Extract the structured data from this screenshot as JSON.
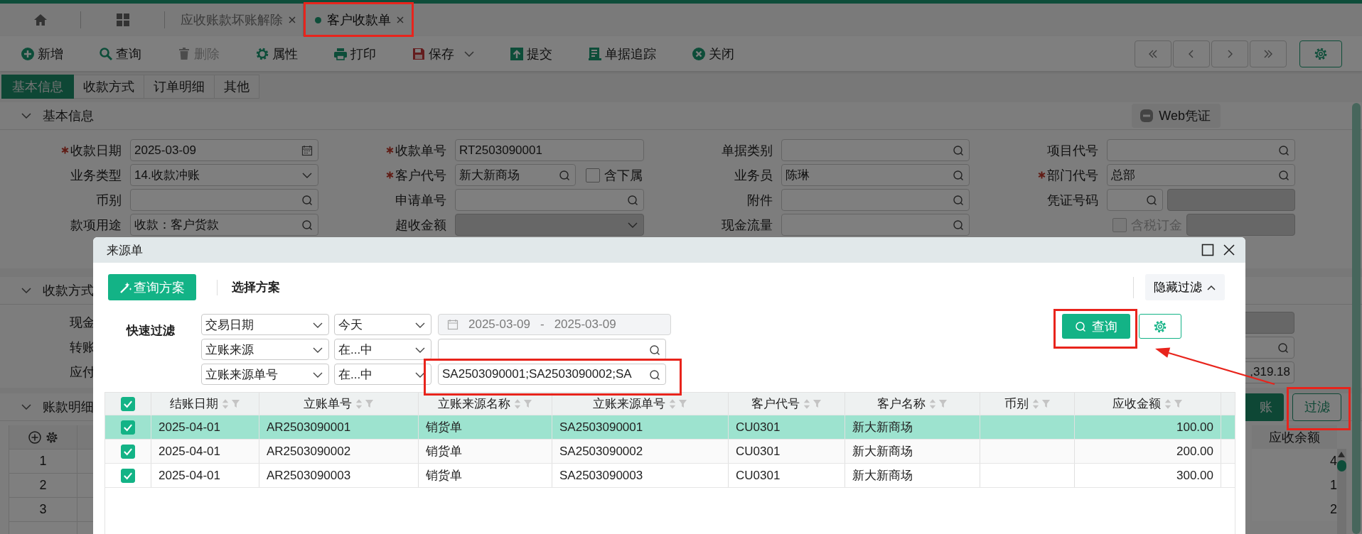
{
  "tab_bar": {
    "tabs": [
      {
        "label": "应收账款坏账解除",
        "selected": false
      },
      {
        "label": "客户收款单",
        "selected": true
      }
    ]
  },
  "toolbar": {
    "buttons": [
      {
        "label": "新增",
        "kind": "add",
        "disabled": false,
        "has_menu": false
      },
      {
        "label": "查询",
        "kind": "search",
        "disabled": false,
        "has_menu": false
      },
      {
        "label": "删除",
        "kind": "delete",
        "disabled": true,
        "has_menu": false
      },
      {
        "label": "属性",
        "kind": "properties",
        "disabled": false,
        "has_menu": false
      },
      {
        "label": "打印",
        "kind": "print",
        "disabled": false,
        "has_menu": false
      },
      {
        "label": "保存",
        "kind": "save",
        "disabled": false,
        "has_menu": true
      },
      {
        "label": "提交",
        "kind": "submit",
        "disabled": false,
        "has_menu": false
      },
      {
        "label": "单据追踪",
        "kind": "track",
        "disabled": false,
        "has_menu": false
      },
      {
        "label": "关闭",
        "kind": "close",
        "disabled": false,
        "has_menu": false
      }
    ]
  },
  "form_tabs": [
    {
      "label": "基本信息",
      "selected": true
    },
    {
      "label": "收款方式",
      "selected": false
    },
    {
      "label": "订单明细",
      "selected": false
    },
    {
      "label": "其他",
      "selected": false
    }
  ],
  "basic_info": {
    "title": "基本信息",
    "expanded": true,
    "voucher_button": "Web凭证",
    "fields": [
      {
        "label": "收款日期",
        "required": true,
        "kind": "date",
        "value": "2025-03-09",
        "disabled": false
      },
      {
        "label": "收款单号",
        "required": true,
        "kind": "text",
        "value": "RT2503090001",
        "disabled": false
      },
      {
        "label": "单据类别",
        "required": false,
        "kind": "lookup",
        "disabled": false
      },
      {
        "label": "项目代号",
        "required": false,
        "kind": "lookup",
        "disabled": false
      },
      {
        "label": "业务类型",
        "required": false,
        "kind": "select",
        "value": "14.收款冲账",
        "disabled": false
      },
      {
        "label": "客户代号",
        "required": true,
        "kind": "lookup_check",
        "value": "新大新商场",
        "disabled": false,
        "option": {
          "label": "含下属",
          "checked": false
        }
      },
      {
        "label": "业务员",
        "required": false,
        "kind": "lookup",
        "value": "陈琳",
        "disabled": false
      },
      {
        "label": "部门代号",
        "required": true,
        "kind": "lookup",
        "value": "总部",
        "disabled": false
      },
      {
        "label": "币别",
        "required": false,
        "kind": "lookup",
        "disabled": false
      },
      {
        "label": "申请单号",
        "required": false,
        "kind": "lookup",
        "disabled": false
      },
      {
        "label": "附件",
        "required": false,
        "kind": "lookup",
        "disabled": false
      },
      {
        "label": "凭证号码",
        "required": false,
        "kind": "voucher",
        "disabled": false
      },
      {
        "label": "款项用途",
        "required": false,
        "kind": "lookup",
        "value": "收款：客户货款",
        "disabled": false
      },
      {
        "label": "超收金额",
        "required": false,
        "kind": "select",
        "disabled": true
      },
      {
        "label": "现金流量",
        "required": false,
        "kind": "lookup",
        "disabled": false
      },
      {
        "required": false,
        "kind": "check_field",
        "disabled": true,
        "option": {
          "label": "含税订金",
          "checked": false
        }
      }
    ]
  },
  "payment_section": {
    "title": "收款方式",
    "expanded": true,
    "rows": [
      {
        "label": "现金",
        "kind": "text"
      },
      {
        "label": "转账",
        "kind": "lookup"
      },
      {
        "label": "应付",
        "kind": "text",
        "value": ",319.18"
      }
    ]
  },
  "detail_section": {
    "title": "账款明细",
    "expanded": true,
    "buttons": [
      {
        "label": "账",
        "kind": "primary"
      },
      {
        "label": "过滤",
        "kind": "outline"
      }
    ],
    "balance_column": "应收余额",
    "rows": [
      {
        "number": "1",
        "balance": "4"
      },
      {
        "number": "2",
        "balance": "1"
      },
      {
        "number": "3",
        "balance": "2"
      }
    ]
  },
  "dialog": {
    "title": "来源单",
    "scheme_button": "查询方案",
    "scheme_select": "选择方案",
    "hide_filter_button": "隐藏过滤",
    "quick_filter_label": "快速过滤",
    "query_button": "查询",
    "filters": [
      {
        "field": "交易日期",
        "operator": "今天",
        "kind": "date_range",
        "from": "2025-03-09",
        "to": "2025-03-09",
        "separator": "-"
      },
      {
        "field": "立账来源",
        "operator": "在...中",
        "kind": "lookup"
      },
      {
        "field": "立账来源单号",
        "operator": "在...中",
        "kind": "lookup",
        "value": "SA2503090001;SA2503090002;SA"
      }
    ],
    "table": {
      "all_checked": true,
      "columns": [
        {
          "label": "结账日期",
          "kind": "text"
        },
        {
          "label": "立账单号",
          "kind": "text"
        },
        {
          "label": "立账来源名称",
          "kind": "text"
        },
        {
          "label": "立账来源单号",
          "kind": "text"
        },
        {
          "label": "客户代号",
          "kind": "text"
        },
        {
          "label": "客户名称",
          "kind": "text"
        },
        {
          "label": "币别",
          "kind": "text"
        },
        {
          "label": "应收金额",
          "kind": "number"
        }
      ],
      "rows": [
        {
          "checked": true,
          "selected": true,
          "cells": [
            "2025-04-01",
            "AR2503090001",
            "销货单",
            "SA2503090001",
            "CU0301",
            "新大新商场",
            null,
            "100.00"
          ]
        },
        {
          "checked": true,
          "selected": false,
          "cells": [
            "2025-04-01",
            "AR2503090002",
            "销货单",
            "SA2503090002",
            "CU0301",
            "新大新商场",
            null,
            "200.00"
          ]
        },
        {
          "checked": true,
          "selected": false,
          "cells": [
            "2025-04-01",
            "AR2503090003",
            "销货单",
            "SA2503090003",
            "CU0301",
            "新大新商场",
            null,
            "300.00"
          ]
        }
      ]
    }
  }
}
